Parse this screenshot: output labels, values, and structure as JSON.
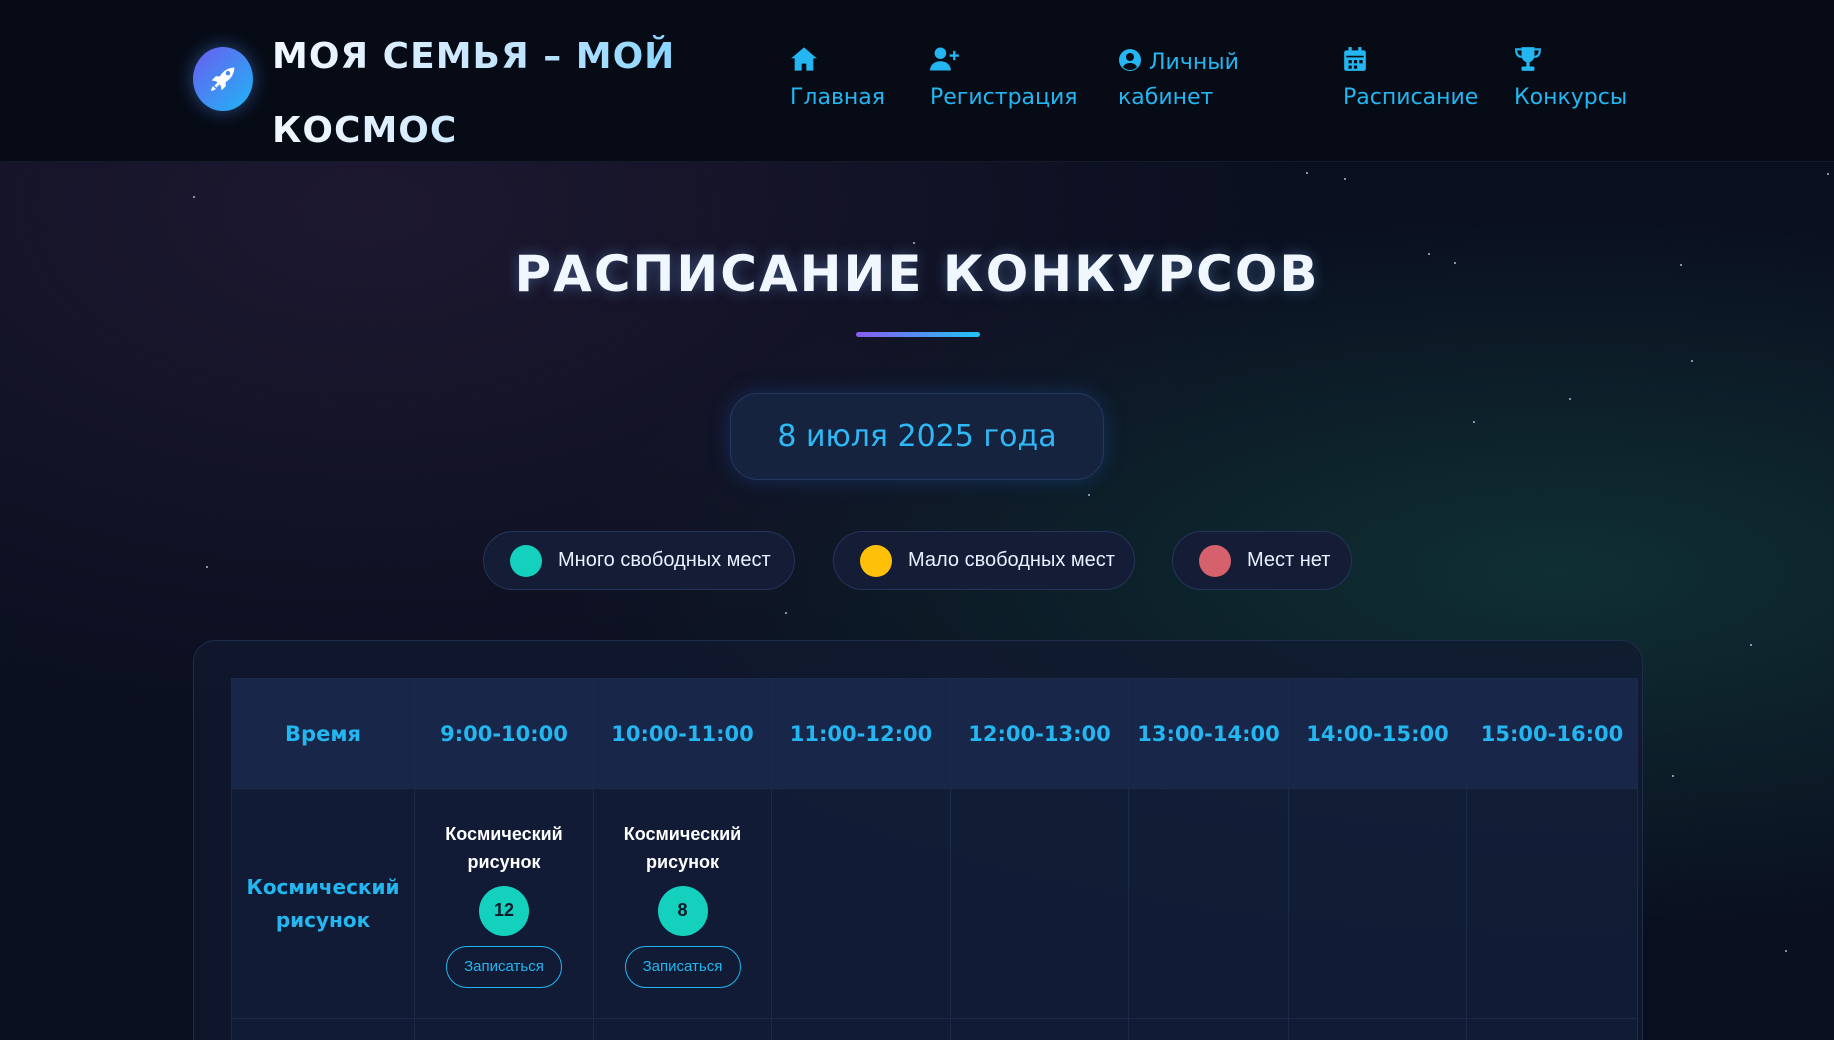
{
  "header": {
    "brand": "МОЯ СЕМЬЯ – МОЙ КОСМОС",
    "logo_icon": "rocket-icon",
    "nav": [
      {
        "label": "Главная",
        "icon": "home-icon"
      },
      {
        "label": "Регистрация",
        "icon": "user-plus-icon"
      },
      {
        "label": "Личный кабинет",
        "icon": "user-circle-icon"
      },
      {
        "label": "Расписание",
        "icon": "calendar-icon"
      },
      {
        "label": "Конкурсы",
        "icon": "trophy-icon"
      }
    ]
  },
  "main": {
    "title": "РАСПИСАНИЕ КОНКУРСОВ",
    "date": "8 июля 2025 года"
  },
  "legend": [
    {
      "label": "Много свободных мест",
      "color": "#14d1bd"
    },
    {
      "label": "Мало свободных мест",
      "color": "#ffc107"
    },
    {
      "label": "Мест нет",
      "color": "#d4616c"
    }
  ],
  "schedule": {
    "headers": [
      "Время",
      "9:00-10:00",
      "10:00-11:00",
      "11:00-12:00",
      "12:00-13:00",
      "13:00-14:00",
      "14:00-15:00",
      "15:00-16:00"
    ],
    "rows": [
      {
        "name": "Космический рисунок",
        "slots": [
          {
            "title": "Космический рисунок",
            "seats": "12",
            "button": "Записаться"
          },
          {
            "title": "Космический рисунок",
            "seats": "8",
            "button": "Записаться"
          }
        ]
      }
    ]
  },
  "colors": {
    "accent": "#23b6f0",
    "available": "#14d1bd"
  }
}
